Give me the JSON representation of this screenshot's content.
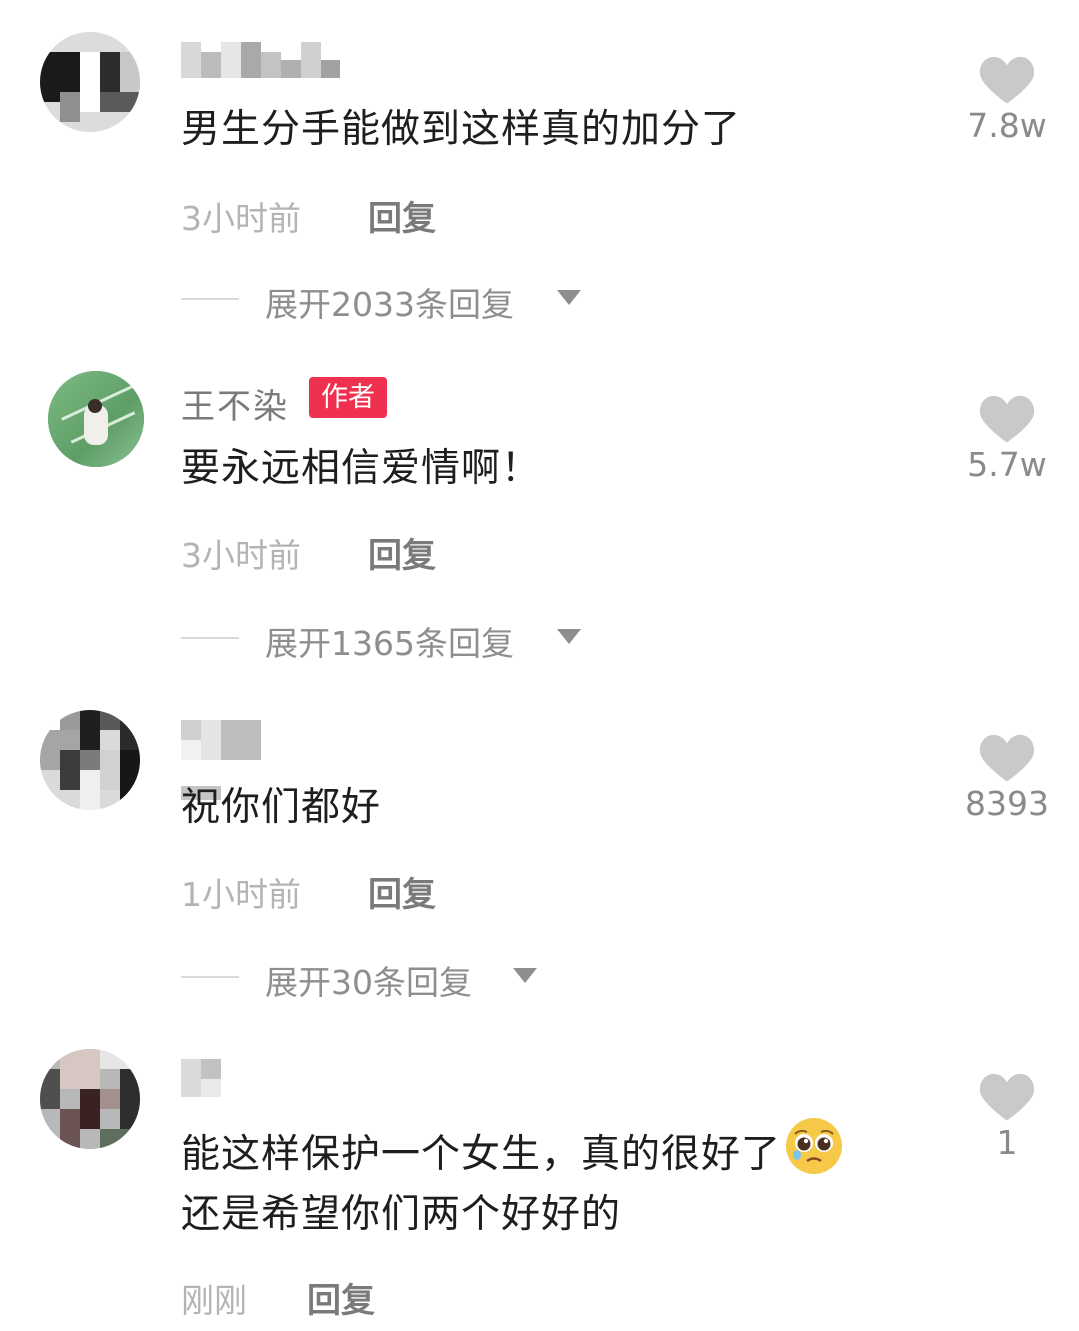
{
  "comments": [
    {
      "text": "男生分手能做到这样真的加分了",
      "time": "3小时前",
      "reply_label": "回复",
      "expand_label": "展开2033条回复",
      "likes": "7.8w"
    },
    {
      "author": "王不染",
      "badge": "作者",
      "text": "要永远相信爱情啊！",
      "time": "3小时前",
      "reply_label": "回复",
      "expand_label": "展开1365条回复",
      "likes": "5.7w"
    },
    {
      "text": "祝你们都好",
      "time": "1小时前",
      "reply_label": "回复",
      "expand_label": "展开30条回复",
      "likes": "8393"
    },
    {
      "text_line1": "能这样保护一个女生，真的很好了",
      "text_line2": "还是希望你们两个好好的",
      "emoji": "pleading-face-icon",
      "time": "刚刚",
      "reply_label": "回复",
      "likes": "1"
    }
  ],
  "colors": {
    "badge": "#f0304f",
    "heart": "#c9c9c9",
    "text": "#1e1e1e",
    "muted": "#b4b4b4"
  }
}
